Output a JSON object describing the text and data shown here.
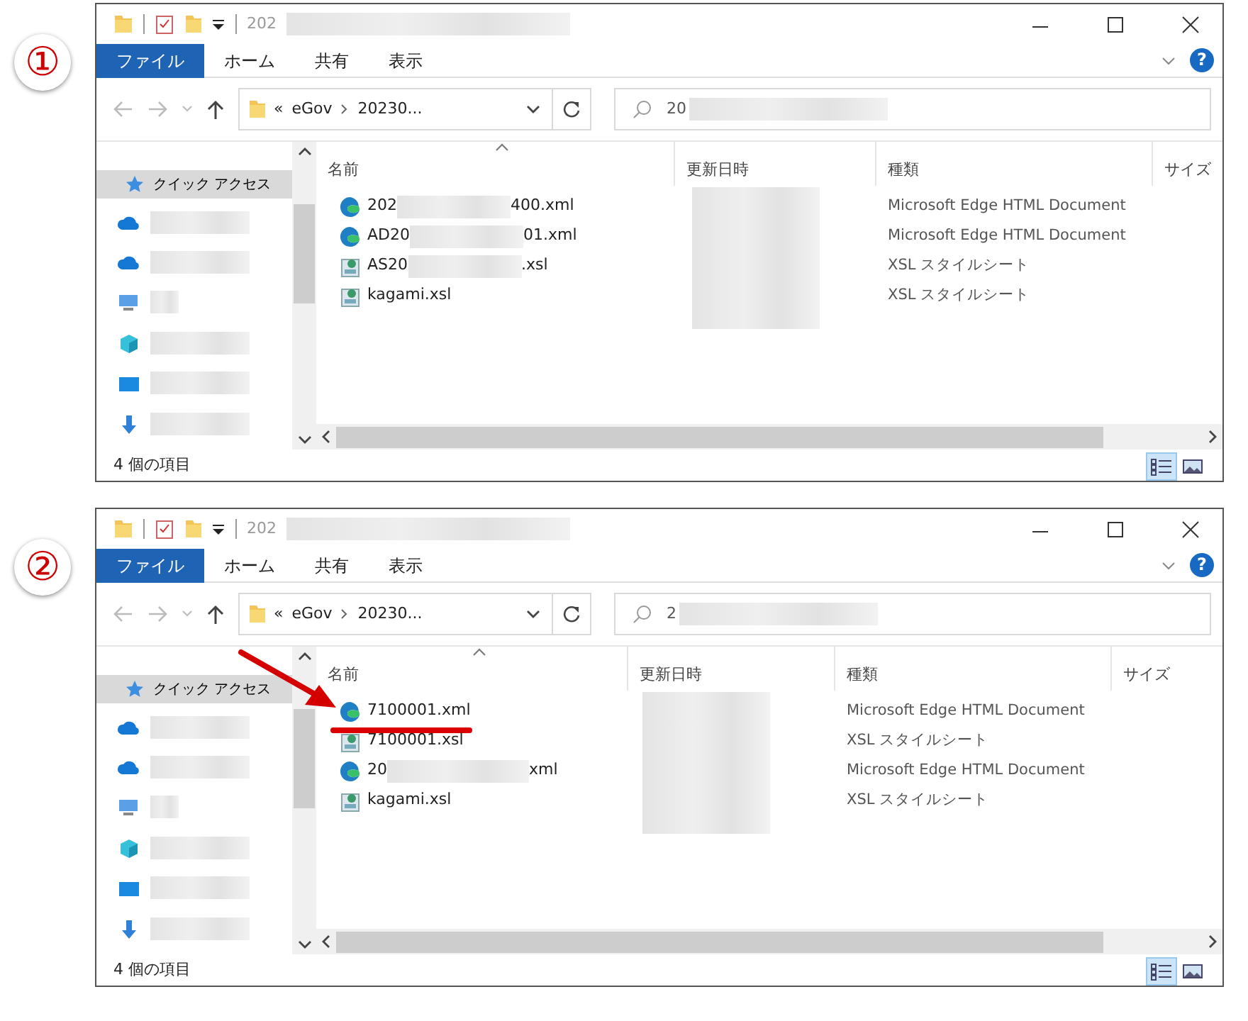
{
  "panels": [
    {
      "step": "①",
      "window": {
        "title": {
          "text": "202",
          "redacted_tail": true
        },
        "ribbon": [
          {
            "kind": "file-menu",
            "label": "ファイル"
          },
          {
            "kind": "tab",
            "label": "ホーム"
          },
          {
            "kind": "tab",
            "label": "共有"
          },
          {
            "kind": "tab",
            "label": "表示"
          }
        ],
        "help": "?",
        "address": {
          "overflow": "«",
          "crumbs": [
            "eGov",
            "20230..."
          ]
        },
        "search": {
          "value": "20",
          "redacted_tail": true
        },
        "sidebar": [
          {
            "kind": "quick-access",
            "label": "クイック アクセス",
            "selected": true
          },
          {
            "kind": "cloud",
            "selected": false
          },
          {
            "kind": "cloud",
            "selected": false
          },
          {
            "kind": "pc",
            "selected": false
          },
          {
            "kind": "cube",
            "selected": false
          },
          {
            "kind": "desktop",
            "selected": false
          },
          {
            "kind": "download",
            "selected": false
          }
        ],
        "columns": [
          {
            "label": "名前",
            "sorted": true
          },
          {
            "label": "更新日時",
            "sorted": false
          },
          {
            "label": "種類",
            "sorted": false
          },
          {
            "label": "サイズ",
            "sorted": false
          }
        ],
        "files": [
          {
            "kind": "edge",
            "name_parts": [
              "202",
              "400.xml"
            ],
            "type": "Microsoft Edge HTML Document",
            "highlighted": false
          },
          {
            "kind": "edge",
            "name_parts": [
              "AD20",
              "01.xml"
            ],
            "type": "Microsoft Edge HTML Document",
            "highlighted": false
          },
          {
            "kind": "xsl",
            "name_parts": [
              "AS20",
              ".xsl"
            ],
            "type": "XSL スタイルシート",
            "highlighted": false
          },
          {
            "kind": "xsl",
            "name_parts": [
              "kagami.xsl"
            ],
            "type": "XSL スタイルシート",
            "highlighted": false
          }
        ],
        "status": "4 個の項目",
        "views": [
          {
            "kind": "details",
            "selected": true
          },
          {
            "kind": "large-icons",
            "selected": false
          }
        ]
      }
    },
    {
      "step": "②",
      "window": {
        "title": {
          "text": "202",
          "redacted_tail": true
        },
        "ribbon": [
          {
            "kind": "file-menu",
            "label": "ファイル"
          },
          {
            "kind": "tab",
            "label": "ホーム"
          },
          {
            "kind": "tab",
            "label": "共有"
          },
          {
            "kind": "tab",
            "label": "表示"
          }
        ],
        "help": "?",
        "address": {
          "overflow": "«",
          "crumbs": [
            "eGov",
            "20230..."
          ]
        },
        "search": {
          "value": "2",
          "redacted_tail": true
        },
        "sidebar": [
          {
            "kind": "quick-access",
            "label": "クイック アクセス",
            "selected": true
          },
          {
            "kind": "cloud",
            "selected": false
          },
          {
            "kind": "cloud",
            "selected": false
          },
          {
            "kind": "pc",
            "selected": false
          },
          {
            "kind": "cube",
            "selected": false
          },
          {
            "kind": "desktop",
            "selected": false
          },
          {
            "kind": "download",
            "selected": false
          }
        ],
        "columns": [
          {
            "label": "名前",
            "sorted": true
          },
          {
            "label": "更新日時",
            "sorted": false
          },
          {
            "label": "種類",
            "sorted": false
          },
          {
            "label": "サイズ",
            "sorted": false
          }
        ],
        "files": [
          {
            "kind": "edge",
            "name_parts": [
              "7100001.xml"
            ],
            "type": "Microsoft Edge HTML Document",
            "highlighted": true
          },
          {
            "kind": "xsl",
            "name_parts": [
              "7100001.xsl"
            ],
            "type": "XSL スタイルシート",
            "highlighted": false
          },
          {
            "kind": "edge",
            "name_parts": [
              "20",
              "xml"
            ],
            "type": "Microsoft Edge HTML Document",
            "highlighted": false
          },
          {
            "kind": "xsl",
            "name_parts": [
              "kagami.xsl"
            ],
            "type": "XSL スタイルシート",
            "highlighted": false
          }
        ],
        "status": "4 個の項目",
        "views": [
          {
            "kind": "details",
            "selected": true
          },
          {
            "kind": "large-icons",
            "selected": false
          }
        ]
      }
    }
  ]
}
